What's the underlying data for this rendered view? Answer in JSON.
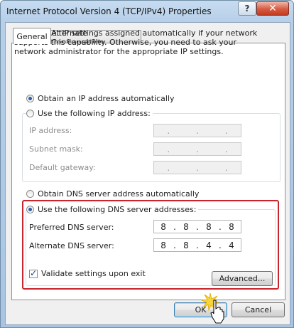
{
  "window": {
    "title": "Internet Protocol Version 4 (TCP/IPv4) Properties",
    "help_label": "?",
    "close_label": "✕"
  },
  "tabs": [
    {
      "label": "General",
      "selected": true
    },
    {
      "label": "Alternate Configuration",
      "selected": false
    }
  ],
  "description": "You can get IP settings assigned automatically if your network supports this capability. Otherwise, you need to ask your network administrator for the appropriate IP settings.",
  "ip_section": {
    "auto_label": "Obtain an IP address automatically",
    "manual_label": "Use the following IP address:",
    "selected": "auto",
    "fields": [
      {
        "label": "IP address:",
        "value": [
          ".",
          ".",
          "."
        ]
      },
      {
        "label": "Subnet mask:",
        "value": [
          ".",
          ".",
          "."
        ]
      },
      {
        "label": "Default gateway:",
        "value": [
          ".",
          ".",
          "."
        ]
      }
    ]
  },
  "dns_section": {
    "auto_label": "Obtain DNS server address automatically",
    "manual_label": "Use the following DNS server addresses:",
    "selected": "manual",
    "preferred": {
      "label": "Preferred DNS server:",
      "octets": [
        "8",
        "8",
        "8",
        "8"
      ]
    },
    "alternate": {
      "label": "Alternate DNS server:",
      "octets": [
        "8",
        "8",
        "4",
        "4"
      ]
    }
  },
  "validate": {
    "label": "Validate settings upon exit",
    "checked": true
  },
  "buttons": {
    "advanced": "Advanced...",
    "ok": "OK",
    "cancel": "Cancel"
  },
  "colors": {
    "highlight": "#c8262e",
    "accent": "#2a5ea8"
  }
}
